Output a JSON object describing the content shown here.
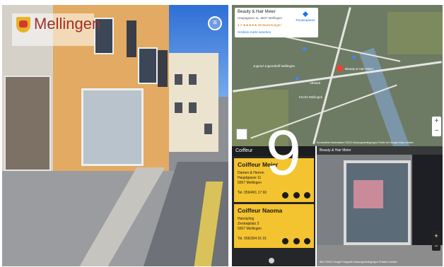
{
  "header": {
    "logo_text": "Mellingen",
    "menu_icon": "hamburger-icon"
  },
  "map": {
    "card_title": "Beauty & Hair Meier",
    "card_address": "Hauptgasse 11, 5507 Mellingen",
    "card_rating": "4,7 ★★★★★ 35 Bewertungen",
    "card_link": "Größere Karte ansehen",
    "card_route": "Routenplaner",
    "labels": [
      "Beauty & Hair Meier",
      "Jugend Jugendtreff Mellingen",
      "Kirche Mellingen",
      "Altstadt"
    ],
    "footer": "Kurzbefehle  Kartendaten ©2022  Nutzungsbedingungen  Fehler bei Google Maps melden"
  },
  "directory": {
    "header": "Coiffeur",
    "entries": [
      {
        "name": "Coiffeur Meier",
        "line1": "Damen & Herren",
        "line2": "Hauptgasse 11",
        "line3": "5507 Mellingen",
        "tel": "Tel. 056/491 17 60"
      },
      {
        "name": "Coiffeur Naoma",
        "line1": "Hairstyling",
        "line2": "Zentralplatz 3",
        "line3": "5507 Mellingen",
        "tel": "Tel. 056/304 01 01"
      }
    ]
  },
  "overlay_number": "9",
  "streetview": {
    "header": "Beauty & Hair Meier",
    "footer": "Bild: ©2022 Google  Fotografie  Nutzungsbedingungen  Problem melden"
  }
}
